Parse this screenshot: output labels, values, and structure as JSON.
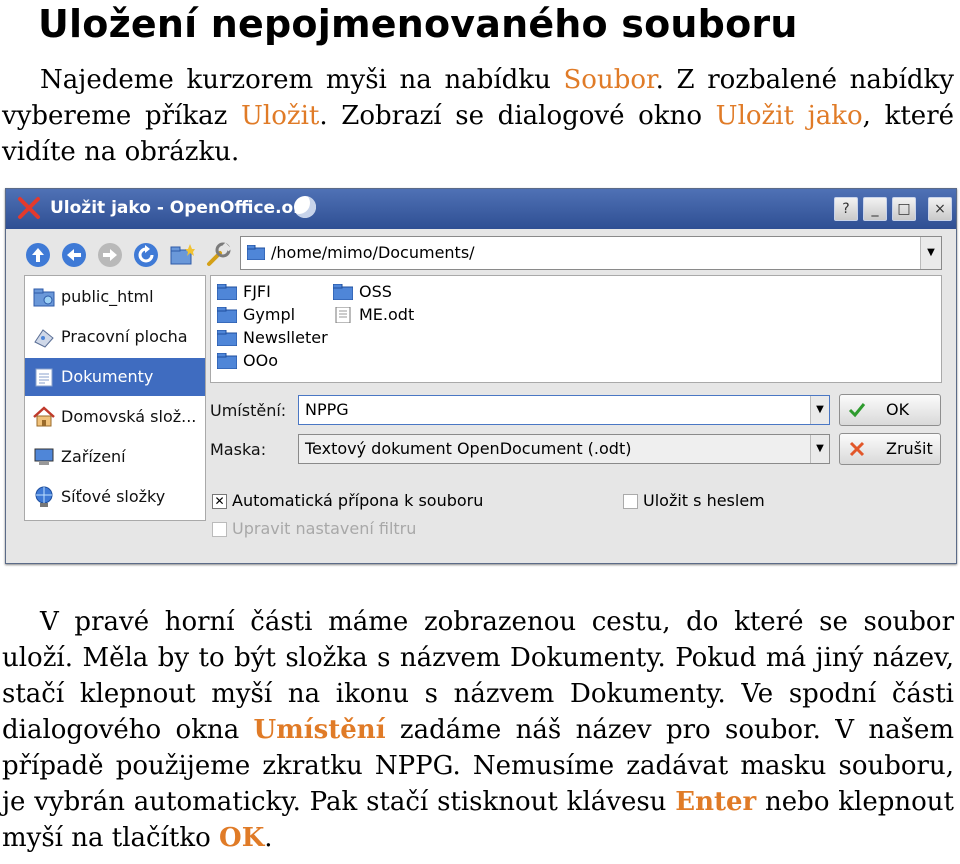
{
  "heading": "Uložení nepojmenovaného souboru",
  "intro": {
    "t1": "Najedeme kurzorem myši na nabídku ",
    "h1": "Soubor",
    "t2": ". Z rozbalené nabídky vybereme příkaz ",
    "h2": "Uložit",
    "t3": ". Zobrazí se dialogové okno ",
    "h3": "Uložit jako",
    "t4": ", které vidíte na obrázku."
  },
  "dialog": {
    "title": "Uložit jako - OpenOffice.org",
    "title_buttons": [
      "?",
      "_",
      "□",
      "×"
    ],
    "path": "/home/mimo/Documents/",
    "sidebar": [
      {
        "label": "public_html",
        "icon": "folder-icon"
      },
      {
        "label": "Pracovní plocha",
        "icon": "desktop-icon"
      },
      {
        "label": "Dokumenty",
        "icon": "documents-icon",
        "selected": true
      },
      {
        "label": "Domovská slož...",
        "icon": "home-icon"
      },
      {
        "label": "Zařízení",
        "icon": "device-icon"
      },
      {
        "label": "Síťové složky",
        "icon": "network-icon"
      }
    ],
    "files": [
      {
        "name": "FJFI",
        "type": "folder"
      },
      {
        "name": "Gympl",
        "type": "folder"
      },
      {
        "name": "Newslleter",
        "type": "folder"
      },
      {
        "name": "OOo",
        "type": "folder"
      },
      {
        "name": "OSS",
        "type": "folder"
      },
      {
        "name": "ME.odt",
        "type": "document"
      }
    ],
    "location_label": "Umístění:",
    "location_value": "NPPG",
    "mask_label": "Maska:",
    "mask_value": "Textový dokument OpenDocument (.odt)",
    "ok_label": "OK",
    "cancel_label": "Zrušit",
    "auto_ext_label": "Automatická přípona k souboru",
    "auto_ext_checked": true,
    "filter_label": "Upravit nastavení filtru",
    "password_label": "Uložit s heslem",
    "colors": {
      "title_bar": "#3a5ea5",
      "selection": "#3f6cc0",
      "accent": "#e07b27"
    }
  },
  "body": {
    "p1": "V pravé horní části máme zobrazenou cestu, do které se soubor uloží. Měla by to být složka s názvem Dokumenty. Pokud má jiný název, stačí klepnout myší na ikonu s názvem Dokumenty. Ve spodní části dialogového okna ",
    "h1": "Umístění",
    "p2": " zadáme náš název pro soubor. V našem případě použijeme zkratku NPPG. Nemusíme zadávat masku souboru, je vybrán automaticky. Pak stačí stisknout klávesu ",
    "h2": "Enter",
    "p3": " nebo klepnout myší na tlačítko ",
    "h3": "OK",
    "p4": "."
  }
}
